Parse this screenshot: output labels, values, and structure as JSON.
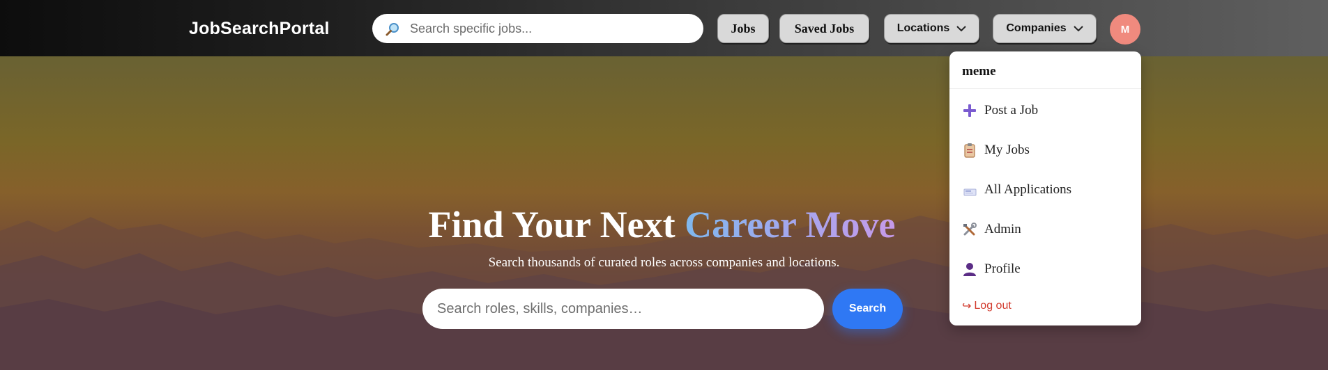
{
  "nav": {
    "brand": "JobSearchPortal",
    "search_placeholder": "Search specific jobs...",
    "search_icon": "magnifier-icon",
    "buttons": {
      "jobs": "Jobs",
      "saved_jobs": "Saved Jobs",
      "locations": "Locations",
      "companies": "Companies"
    },
    "avatar_initial": "M",
    "avatar_color": "#f08a7e"
  },
  "dropdown": {
    "username": "meme",
    "items": [
      {
        "label": "Post a Job",
        "icon": "plus-icon"
      },
      {
        "label": "My Jobs",
        "icon": "clipboard-icon"
      },
      {
        "label": "All Applications",
        "icon": "cards-icon"
      },
      {
        "label": "Admin",
        "icon": "tools-icon"
      },
      {
        "label": "Profile",
        "icon": "person-icon"
      }
    ],
    "logout": "Log out",
    "logout_color": "#d23b2e"
  },
  "hero": {
    "title_main": "Find Your Next ",
    "title_accent": "Career Move",
    "subtitle": "Search thousands of curated roles across companies and locations.",
    "search_placeholder": "Search roles, skills, companies…",
    "search_button": "Search",
    "accent_color": "#2f78f4"
  }
}
